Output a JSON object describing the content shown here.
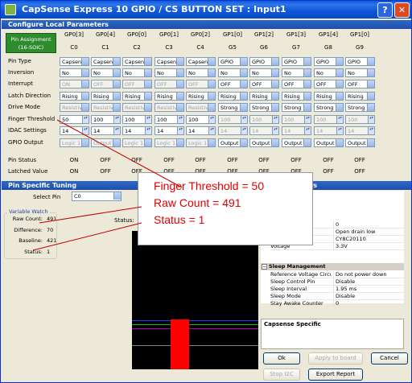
{
  "window": {
    "title": "CapSense Express 10 GPIO / CS BUTTON SET : Input1",
    "help_glyph": "?",
    "close_glyph": "✕"
  },
  "config": {
    "header": "Configure Local Parameters",
    "pin_assignment": {
      "line1": "Pin Assignment",
      "line2": "(16-SOIC)"
    },
    "columns": [
      {
        "gpio": "GP0[3]",
        "pin": "C0"
      },
      {
        "gpio": "GP0[4]",
        "pin": "C1"
      },
      {
        "gpio": "GP0[0]",
        "pin": "C2"
      },
      {
        "gpio": "GP0[1]",
        "pin": "C3"
      },
      {
        "gpio": "GP0[2]",
        "pin": "C4"
      },
      {
        "gpio": "GP1[0]",
        "pin": "G5"
      },
      {
        "gpio": "GP1[2]",
        "pin": "G6"
      },
      {
        "gpio": "GP1[3]",
        "pin": "G7"
      },
      {
        "gpio": "GP1[4]",
        "pin": "G8"
      },
      {
        "gpio": "GP1[0]",
        "pin": "G9"
      }
    ],
    "rows": {
      "pin_type": {
        "label": "Pin Type",
        "values": [
          "Capsen",
          "Capsen",
          "Capsen",
          "Capsen",
          "Capsen",
          "GPIO",
          "GPIO",
          "GPIO",
          "GPIO",
          "GPIO"
        ]
      },
      "inversion": {
        "label": "Inversion",
        "values": [
          "No",
          "No",
          "No",
          "No",
          "No",
          "No",
          "No",
          "No",
          "No",
          "No"
        ]
      },
      "interrupt": {
        "label": "Interrupt",
        "values": [
          "ON",
          "OFF",
          "OFF",
          "OFF",
          "OFF",
          "OFF",
          "OFF",
          "OFF",
          "OFF",
          "OFF"
        ]
      },
      "latch_direction": {
        "label": "Latch Direction",
        "values": [
          "Rising",
          "Rising",
          "Rising",
          "Rising",
          "Rising",
          "Rising",
          "Rising",
          "Rising",
          "Rising",
          "Rising"
        ]
      },
      "drive_mode": {
        "label": "Drive Mode",
        "values": [
          "Resistiv",
          "Resistiv",
          "Resistiv",
          "Resistiv",
          "Resistiv",
          "Strong D",
          "Strong D",
          "Strong D",
          "Strong D",
          "Strong D"
        ]
      },
      "finger_threshold": {
        "label": "Finger Threshold",
        "values": [
          "50",
          "100",
          "100",
          "100",
          "100",
          "100",
          "100",
          "100",
          "100",
          "100"
        ]
      },
      "idac_settings": {
        "label": "IDAC Settings",
        "values": [
          "14",
          "14",
          "14",
          "14",
          "14",
          "14",
          "14",
          "14",
          "14",
          "14"
        ]
      },
      "gpio_output": {
        "label": "GPIO Output",
        "values": [
          "Logic 1",
          "Output I",
          "Logic 1",
          "Logic 1",
          "Logic 1",
          "Output I",
          "Output I",
          "Output I",
          "Output I",
          "Output L"
        ]
      },
      "pin_status": {
        "label": "Pin Status",
        "values": [
          "ON",
          "OFF",
          "OFF",
          "OFF",
          "OFF",
          "OFF",
          "OFF",
          "OFF",
          "OFF",
          "OFF"
        ]
      },
      "latched_value": {
        "label": "Latched Value",
        "values": [
          "ON",
          "OFF",
          "OFF",
          "OFF",
          "OFF",
          "OFF",
          "OFF",
          "OFF",
          "OFF",
          "OFF"
        ]
      }
    }
  },
  "tuning": {
    "header": "Pin Specific Tuning",
    "select_pin_label": "Select Pin",
    "select_pin_value": "C0",
    "status_label": "Status:",
    "variable_watch": {
      "title": "Variable Watch",
      "items": [
        {
          "key": "Raw Count:",
          "value": "491"
        },
        {
          "key": "Difference:",
          "value": "70"
        },
        {
          "key": "Baseline:",
          "value": "421"
        },
        {
          "key": "Status:",
          "value": "1"
        }
      ]
    }
  },
  "global": {
    "header_tail": "al Parameters",
    "top_values": [
      "0",
      "Open drain low",
      "CY8C20110"
    ],
    "voltage": {
      "key": "Voltage",
      "value": "3.3V"
    },
    "sleep_group": "Sleep Management",
    "sleep_rows": [
      {
        "key": "Reference Voltage Circu",
        "value": "Do not power down"
      },
      {
        "key": "Sleep Control Pin",
        "value": "Disable"
      },
      {
        "key": "Sleep Interval",
        "value": "1.95 ms"
      },
      {
        "key": "Sleep Mode",
        "value": "Disable"
      },
      {
        "key": "Stay Awake Counter",
        "value": "0"
      }
    ],
    "description_title": "Capsense Specific"
  },
  "buttons": {
    "ok": "Ok",
    "apply": "Apply to board",
    "cancel": "Cancel",
    "stop_i2c": "Stop I2C",
    "export": "Export Report"
  },
  "callout": {
    "line1": "Finger Threshold = 50",
    "line2": "Raw Count = 491",
    "line3": "Status = 1"
  },
  "colors": {
    "title_blue": "#0a5ad8",
    "section_blue": "#2d67c8",
    "pin_assign_green": "#2e8b2e",
    "annotation_red": "#e00000",
    "signal_bar_red": "#ff0000"
  }
}
